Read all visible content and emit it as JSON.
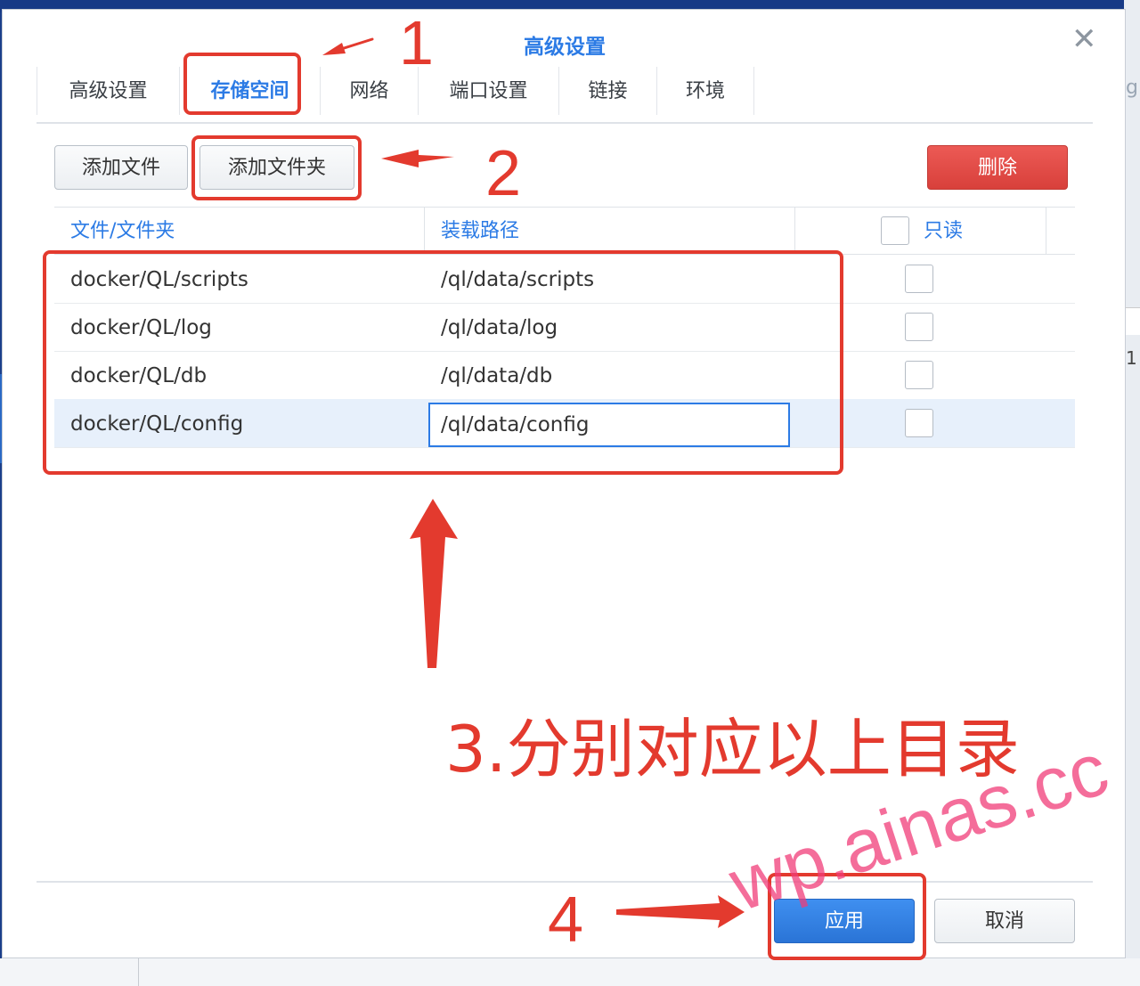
{
  "dialog": {
    "title": "高级设置",
    "close_icon": "close-icon"
  },
  "tabs": [
    {
      "label": "高级设置",
      "active": false
    },
    {
      "label": "存储空间",
      "active": true
    },
    {
      "label": "网络",
      "active": false
    },
    {
      "label": "端口设置",
      "active": false
    },
    {
      "label": "链接",
      "active": false
    },
    {
      "label": "环境",
      "active": false
    }
  ],
  "toolbar": {
    "add_file": "添加文件",
    "add_folder": "添加文件夹",
    "delete": "删除"
  },
  "table": {
    "headers": {
      "file": "文件/文件夹",
      "mount": "装载路径",
      "readonly": "只读"
    },
    "rows": [
      {
        "file": "docker/QL/scripts",
        "mount": "/ql/data/scripts",
        "readonly": false
      },
      {
        "file": "docker/QL/log",
        "mount": "/ql/data/log",
        "readonly": false
      },
      {
        "file": "docker/QL/db",
        "mount": "/ql/data/db",
        "readonly": false
      },
      {
        "file": "docker/QL/config",
        "mount": "/ql/data/config",
        "readonly": false,
        "selected": true
      }
    ]
  },
  "footer": {
    "apply": "应用",
    "cancel": "取消"
  },
  "annotations": {
    "n1": "1",
    "n2": "2",
    "n3": "3.分别对应以上目录",
    "n4": "4",
    "color": "#e33a2e"
  },
  "watermark": "wp.ainas.cc",
  "background": {
    "right_glyph": "g",
    "right_number": "1"
  }
}
